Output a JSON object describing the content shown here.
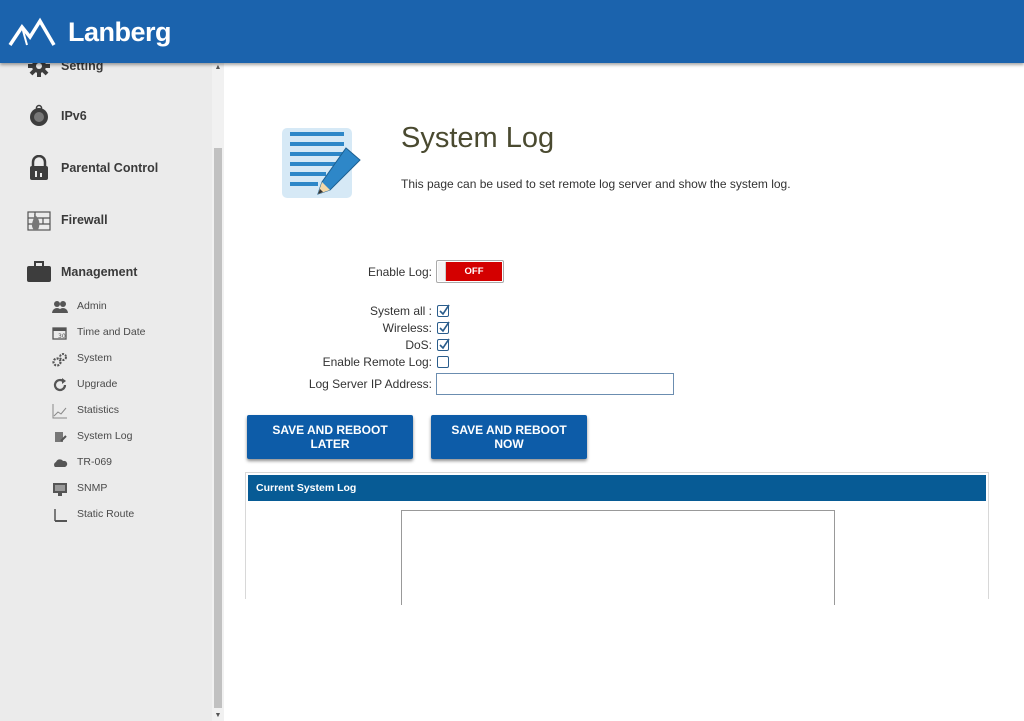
{
  "brand": {
    "name": "Lanberg"
  },
  "colors": {
    "header": "#1b63ad",
    "button": "#0d5ca8",
    "toggle_off": "#d40000",
    "panel_header": "#075b95"
  },
  "sidebar": {
    "items": [
      {
        "label": "Setting",
        "icon": "gear-icon"
      },
      {
        "label": "IPv6",
        "icon": "ipv6-icon"
      },
      {
        "label": "Parental Control",
        "icon": "lock-icon"
      },
      {
        "label": "Firewall",
        "icon": "firewall-icon"
      },
      {
        "label": "Management",
        "icon": "briefcase-icon"
      }
    ],
    "subitems": [
      {
        "label": "Admin",
        "icon": "users-icon"
      },
      {
        "label": "Time and Date",
        "icon": "calendar-icon"
      },
      {
        "label": "System",
        "icon": "gears-icon"
      },
      {
        "label": "Upgrade",
        "icon": "refresh-icon"
      },
      {
        "label": "Statistics",
        "icon": "chart-icon"
      },
      {
        "label": "System Log",
        "icon": "log-icon"
      },
      {
        "label": "TR-069",
        "icon": "cloud-icon"
      },
      {
        "label": "SNMP",
        "icon": "monitor-icon"
      },
      {
        "label": "Static Route",
        "icon": "route-icon"
      }
    ]
  },
  "main": {
    "title": "System Log",
    "description": "This page can be used to set remote log server and show the system log.",
    "form": {
      "enable_log_label": "Enable Log:",
      "enable_log_state": "OFF",
      "system_all_label": "System all :",
      "system_all_checked": true,
      "wireless_label": "Wireless:",
      "wireless_checked": true,
      "dos_label": "DoS:",
      "dos_checked": true,
      "remote_log_label": "Enable Remote Log:",
      "remote_log_checked": false,
      "server_ip_label": "Log Server IP Address:",
      "server_ip_value": ""
    },
    "buttons": {
      "save_later": "SAVE AND REBOOT LATER",
      "save_now": "SAVE AND REBOOT NOW"
    },
    "log_panel": {
      "title": "Current System Log",
      "content": ""
    }
  }
}
